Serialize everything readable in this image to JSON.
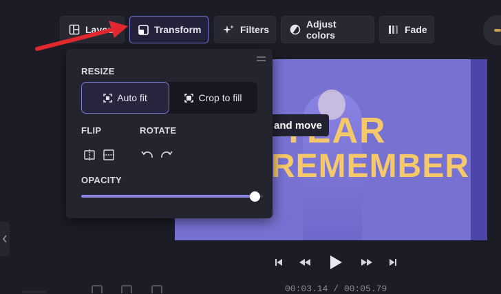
{
  "toolbar": {
    "buttons": [
      {
        "id": "layout",
        "label": "Layout",
        "icon": "layout-icon"
      },
      {
        "id": "transform",
        "label": "Transform",
        "icon": "transform-icon",
        "active": true
      },
      {
        "id": "filters",
        "label": "Filters",
        "icon": "sparkle-icon"
      },
      {
        "id": "adjust",
        "label": "Adjust colors",
        "icon": "half-circle-icon"
      },
      {
        "id": "fade",
        "label": "Fade",
        "icon": "fade-icon"
      }
    ]
  },
  "transform_panel": {
    "resize_label": "RESIZE",
    "auto_fit_label": "Auto fit",
    "crop_to_fill_label": "Crop to fill",
    "selected_resize": "auto_fit",
    "flip_label": "FLIP",
    "rotate_label": "ROTATE",
    "opacity_label": "OPACITY",
    "opacity_value": 1.0
  },
  "preview": {
    "title_line1": "A YEAR",
    "title_line2": "REMEMBER",
    "drag_hint": "and move"
  },
  "player": {
    "timecode": "00:03.14 / 00:05.79"
  },
  "colors": {
    "accent": "#7d78d6",
    "annotation_arrow": "#e0282e",
    "preview_bg": "#7771d2",
    "title_text": "#f5c86a"
  }
}
